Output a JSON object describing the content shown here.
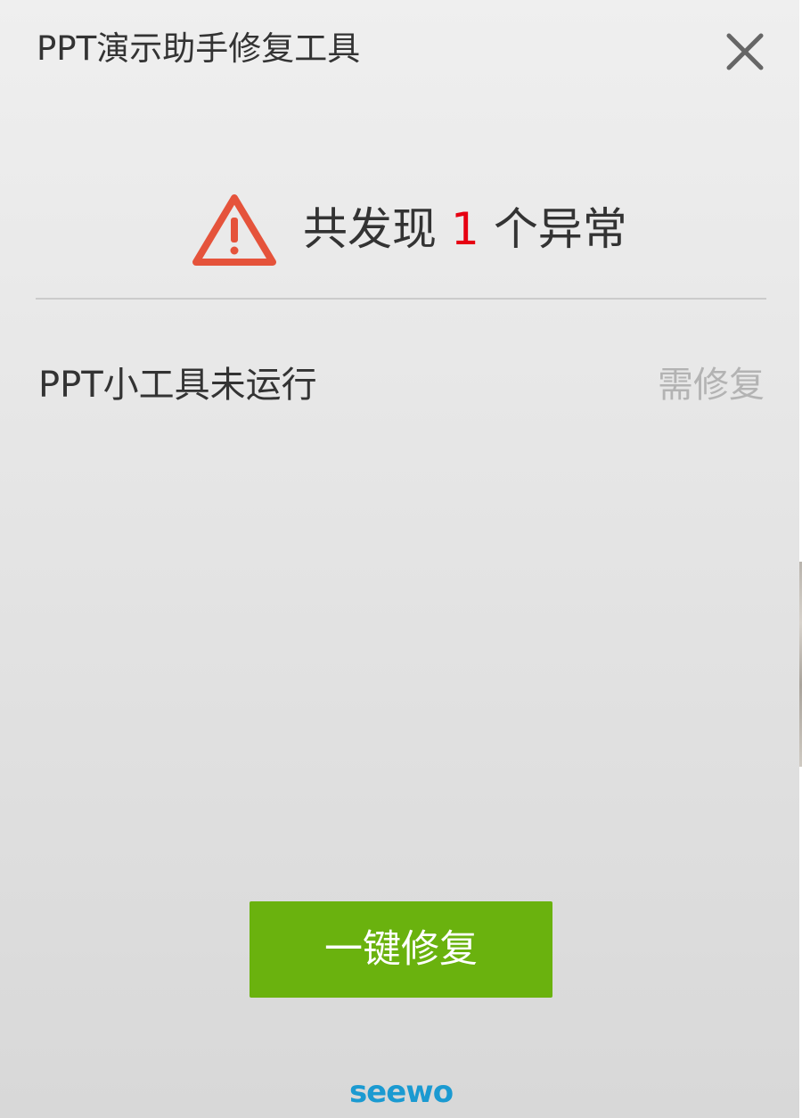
{
  "window": {
    "title": "PPT演示助手修复工具",
    "close_icon": "close-icon"
  },
  "summary": {
    "prefix": "共发现",
    "count": "1",
    "suffix": "个异常",
    "icon": "warning-triangle-icon",
    "icon_color": "#e5533b",
    "count_color": "#e60012"
  },
  "issues": [
    {
      "name": "PPT小工具未运行",
      "status": "需修复"
    }
  ],
  "actions": {
    "fix_all_label": "一键修复",
    "fix_button_color": "#6ab20e"
  },
  "footer": {
    "logo_text": "seewo",
    "logo_color": "#1b9ad1"
  }
}
